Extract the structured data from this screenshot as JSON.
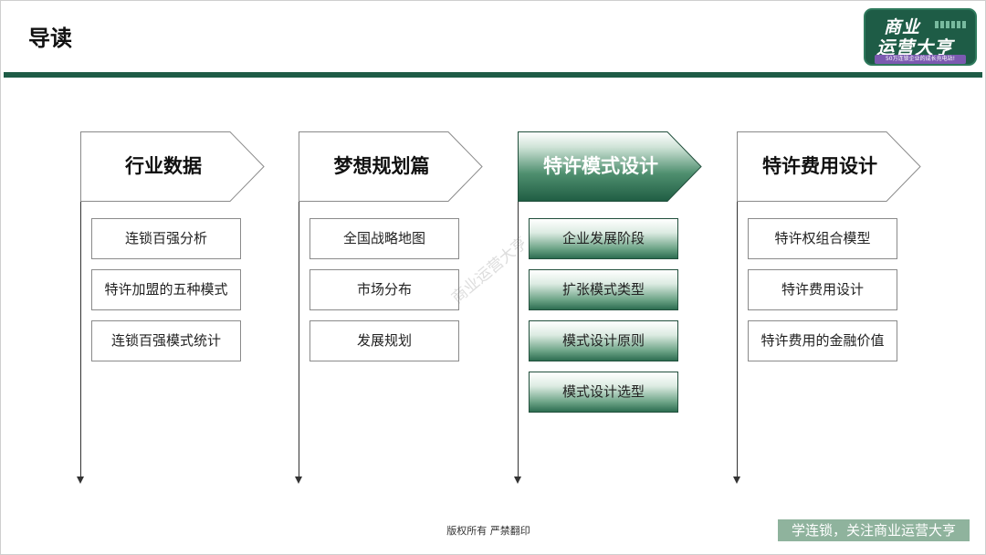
{
  "header": {
    "title": "导读",
    "logo": {
      "line1": "商业",
      "line2": "运营大亨",
      "tagline": "50万连锁企业的成长充电站!"
    }
  },
  "colors": {
    "accent_green": "#1e5c46",
    "active_gradient_dark": "#2d6d51",
    "footer_badge": "#8fb39d",
    "logo_tag_purple": "#7b5ab0"
  },
  "columns": [
    {
      "label": "行业数据",
      "active": false,
      "items": [
        "连锁百强分析",
        "特许加盟的五种模式",
        "连锁百强模式统计"
      ]
    },
    {
      "label": "梦想规划篇",
      "active": false,
      "items": [
        "全国战略地图",
        "市场分布",
        "发展规划"
      ]
    },
    {
      "label": "特许模式设计",
      "active": true,
      "items": [
        "企业发展阶段",
        "扩张模式类型",
        "模式设计原则",
        "模式设计选型"
      ]
    },
    {
      "label": "特许费用设计",
      "active": false,
      "items": [
        "特许权组合模型",
        "特许费用设计",
        "特许费用的金融价值"
      ]
    }
  ],
  "watermark": "商业运营大亨",
  "footer": {
    "copyright": "版权所有 严禁翻印",
    "badge": "学连锁，关注商业运营大亨"
  }
}
